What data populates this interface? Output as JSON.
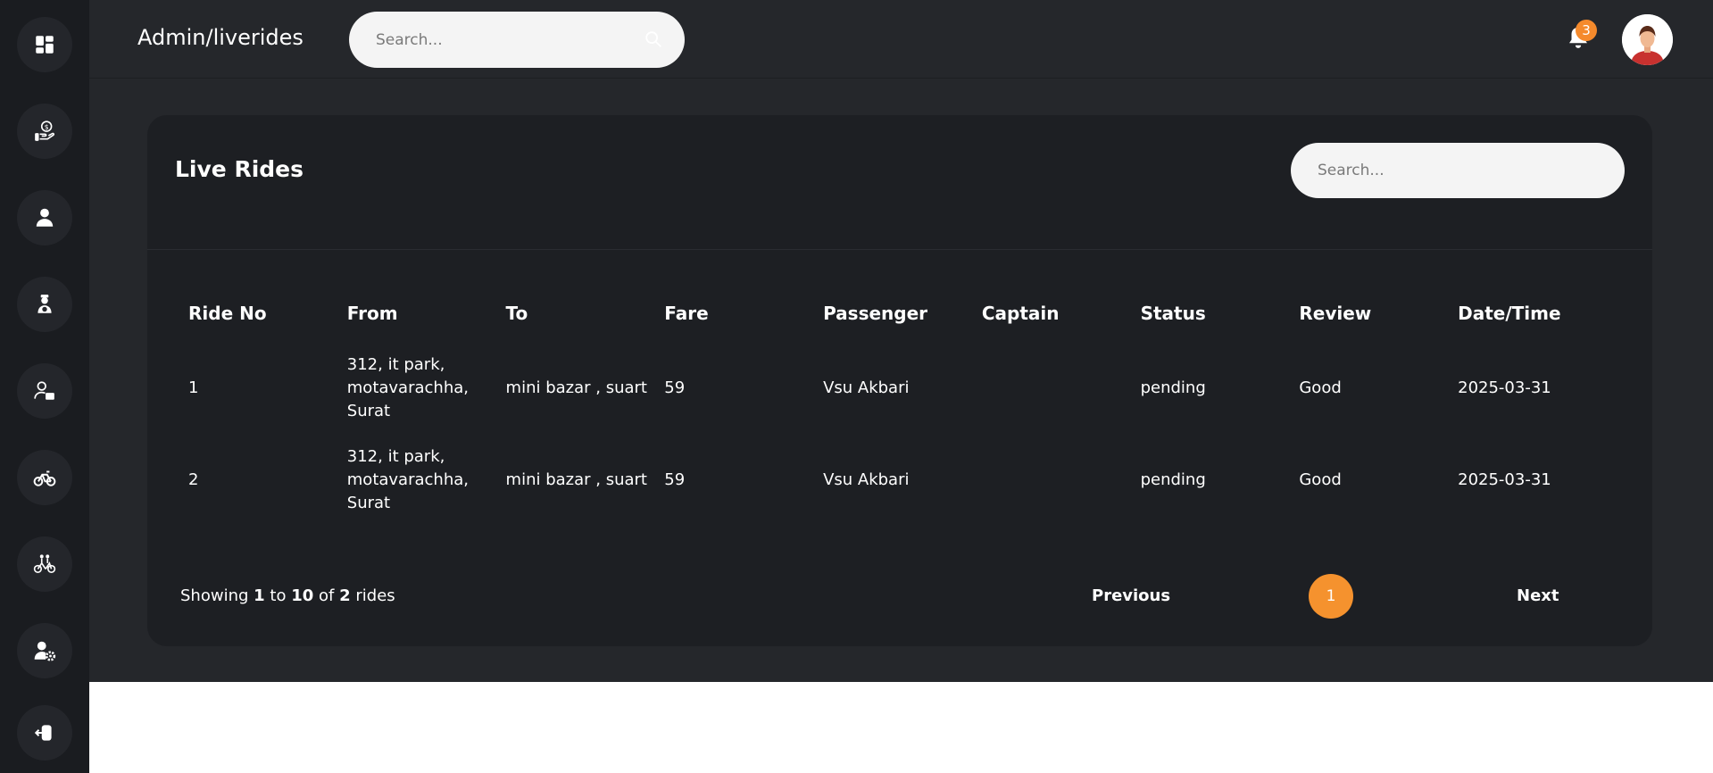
{
  "sidebar": {
    "items": [
      {
        "icon": "dashboard-icon"
      },
      {
        "icon": "payment-hand-icon"
      },
      {
        "icon": "user-icon"
      },
      {
        "icon": "driver-icon"
      },
      {
        "icon": "user-card-icon"
      },
      {
        "icon": "bike-icon"
      },
      {
        "icon": "cyclist-icon"
      },
      {
        "icon": "user-settings-icon"
      },
      {
        "icon": "logout-icon"
      }
    ]
  },
  "header": {
    "breadcrumb": "Admin/liverides",
    "search_placeholder": "Search...",
    "notification_count": "3"
  },
  "card": {
    "title": "Live Rides",
    "search_placeholder": "Search...",
    "columns": [
      "Ride No",
      "From",
      "To",
      "Fare",
      "Passenger",
      "Captain",
      "Status",
      "Review",
      "Date/Time"
    ],
    "rows": [
      [
        "1",
        "312, it park, motavarachha, Surat",
        "mini bazar , suart",
        "59",
        "Vsu Akbari",
        "",
        "pending",
        "Good",
        "2025-03-31"
      ],
      [
        "2",
        "312, it park, motavarachha, Surat",
        "mini bazar , suart",
        "59",
        "Vsu Akbari",
        "",
        "pending",
        "Good",
        "2025-03-31"
      ]
    ]
  },
  "pagination": {
    "showing_prefix": "Showing",
    "from": "1",
    "to_word": "to",
    "to": "10",
    "of_word": "of",
    "total": "2",
    "suffix": "rides",
    "previous_label": "Previous",
    "current_page": "1",
    "next_label": "Next"
  },
  "colors": {
    "accent": "#f5922e",
    "sidebar_bg": "#1a1c20",
    "main_bg": "#25272b",
    "card_bg": "#1d1f23"
  }
}
